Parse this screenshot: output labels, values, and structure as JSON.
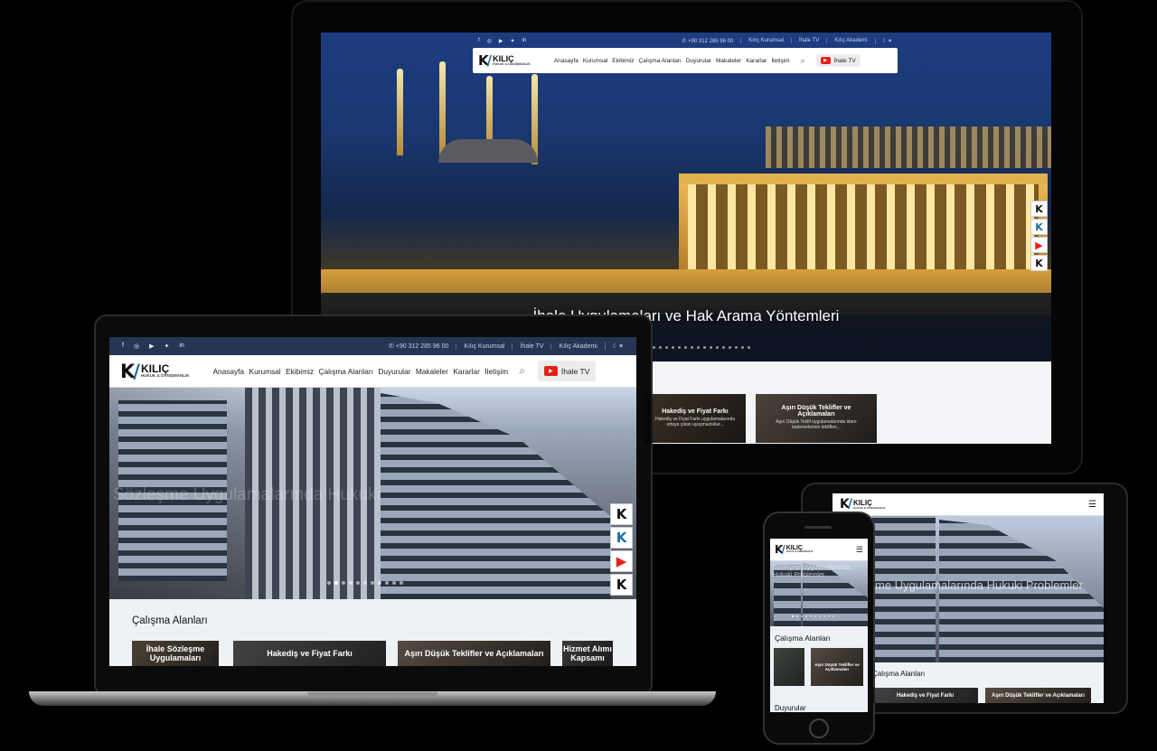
{
  "brand": {
    "name": "KILIÇ",
    "tagline": "HUKUK & DANIŞMANLIK",
    "accent_blue": "#1c6e9e",
    "youtube_red": "#e62117"
  },
  "topbar": {
    "phone": "+90 312 285 96 00",
    "links": [
      "Kılıç Kurumsal",
      "İhale TV",
      "Kılıç Akademi"
    ],
    "social_icons": [
      "facebook-icon",
      "instagram-icon",
      "youtube-icon",
      "twitter-icon",
      "linkedin-icon"
    ]
  },
  "nav": {
    "menu": [
      "Anasayfa",
      "Kurumsal",
      "Ekibimiz",
      "Çalışma Alanları",
      "Duyurular",
      "Makaleler",
      "Kararlar",
      "İletişim"
    ],
    "tv_button": "İhale TV"
  },
  "desktop": {
    "hero_title": "İhale Uygulamaları ve Hak Arama Yöntemleri",
    "cards": [
      {
        "title": "Hakediş ve Fiyat Farkı",
        "desc": "Hakediş ve Fiyat Farkı uygulamalarında ortaya çıkan uyuşmazlıklar..."
      },
      {
        "title": "Aşırı Düşük Teklifler ve Açıklamaları",
        "desc": "Aşırı Düşük Teklif uygulamalarında idare kademelerinin teklifleri..."
      }
    ]
  },
  "laptop": {
    "hero_ghost": "Sözleşme Uygulamalarında Hukuki",
    "section_title": "Çalışma Alanları",
    "cards": [
      "İhale Sözleşme Uygulamaları",
      "Hakediş ve Fiyat Farkı",
      "Aşırı Düşük Teklifler ve Açıklamaları",
      "Hizmet Alımı Kapsamı"
    ]
  },
  "tablet": {
    "hero_title": "Sözleşme Uygulamalarında Hukuki Problemler",
    "section_title": "Çalışma Alanları",
    "cards": [
      "Hakediş ve Fiyat Farkı",
      "Aşırı Düşük Teklifler ve Açıklamaları"
    ]
  },
  "phone": {
    "hero_title": "Sözleşme Uygulamalarında Hukuki Problemler",
    "section_title": "Çalışma Alanları",
    "section2_title": "Duyurular",
    "cards": [
      "",
      "Aşırı Düşük Teklifler ve Açıklamaları"
    ]
  }
}
